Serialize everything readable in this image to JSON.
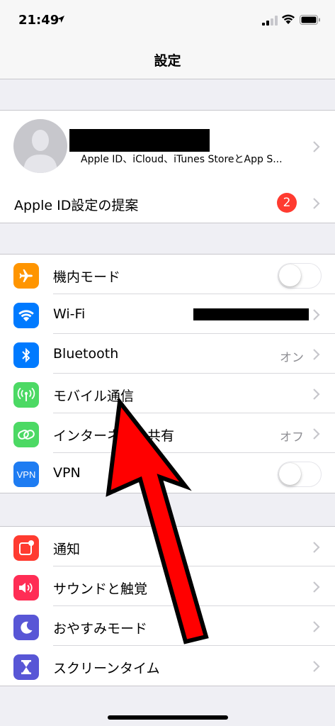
{
  "status": {
    "time": "21:49"
  },
  "nav": {
    "title": "設定"
  },
  "profile": {
    "subtitle": "Apple ID、iCloud、iTunes StoreとApp S...",
    "suggestion_label": "Apple ID設定の提案",
    "suggestion_badge": "2"
  },
  "connectivity": {
    "items": [
      {
        "label": "機内モード",
        "icon": "airplane-icon",
        "color": "#ff9500",
        "control": "toggle-off"
      },
      {
        "label": "Wi-Fi",
        "icon": "wifi-icon",
        "color": "#007aff",
        "control": "chevron"
      },
      {
        "label": "Bluetooth",
        "icon": "bluetooth-icon",
        "color": "#007aff",
        "value": "オン",
        "control": "chevron"
      },
      {
        "label": "モバイル通信",
        "icon": "antenna-icon",
        "color": "#4cd964",
        "control": "chevron"
      },
      {
        "label": "インターネット共有",
        "icon": "hotspot-icon",
        "color": "#4cd964",
        "value": "オフ",
        "control": "chevron"
      },
      {
        "label": "VPN",
        "icon": "vpn-icon",
        "color": "#1e7cf2",
        "control": "toggle-off"
      }
    ]
  },
  "notifications": {
    "items": [
      {
        "label": "通知",
        "icon": "notification-icon",
        "color": "#ff3b30"
      },
      {
        "label": "サウンドと触覚",
        "icon": "speaker-icon",
        "color": "#ff2d55"
      },
      {
        "label": "おやすみモード",
        "icon": "moon-icon",
        "color": "#5856d6"
      },
      {
        "label": "スクリーンタイム",
        "icon": "hourglass-icon",
        "color": "#5856d6"
      }
    ]
  },
  "vpn_icon_text": "VPN",
  "colors": {
    "annotation_arrow": "#ff0000",
    "badge": "#ff3b30",
    "background": "#efeff4"
  }
}
